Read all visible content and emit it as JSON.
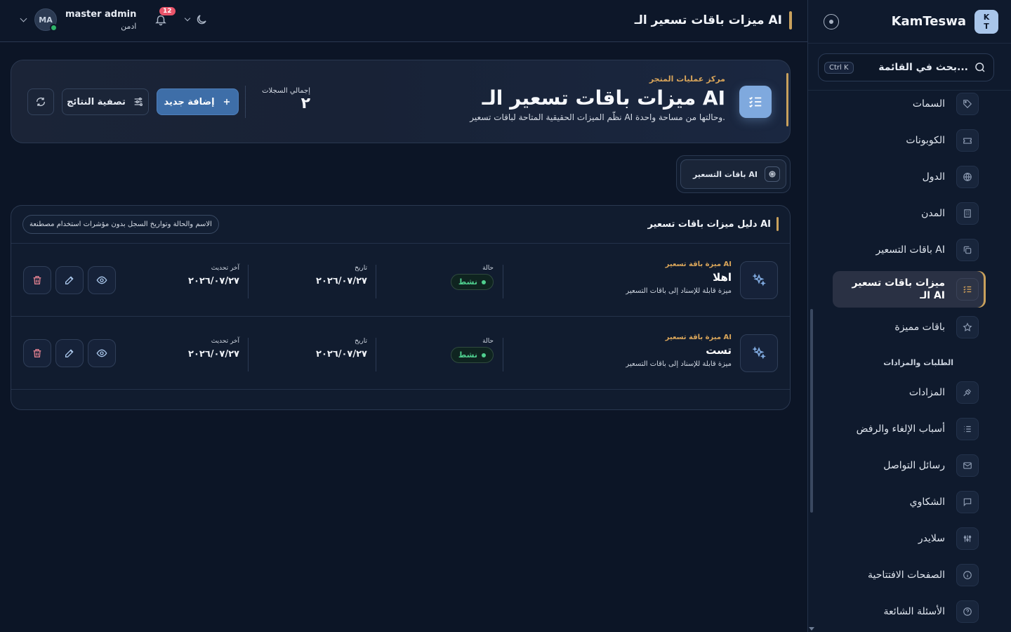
{
  "brand": {
    "logo_line1": "K",
    "logo_line2": "T",
    "name": "KamTeswa"
  },
  "search": {
    "placeholder": "بحث في القائمة...",
    "shortcut": "Ctrl K"
  },
  "sidebar": {
    "items": [
      {
        "label": "السمات",
        "icon": "tag-icon"
      },
      {
        "label": "الكوبونات",
        "icon": "ticket-icon"
      },
      {
        "label": "الدول",
        "icon": "globe-icon"
      },
      {
        "label": "المدن",
        "icon": "building-icon"
      },
      {
        "label": "باقات التسعير AI",
        "icon": "copy-icon"
      },
      {
        "label": "ميزات باقات تسعير الـ AI",
        "icon": "list-check-icon",
        "active": true
      },
      {
        "label": "باقات مميزة",
        "icon": "star-icon"
      }
    ],
    "section_label": "الطلبات والمزادات",
    "section_items": [
      {
        "label": "المزادات",
        "icon": "gavel-icon"
      },
      {
        "label": "أسباب الإلغاء والرفض",
        "icon": "list-icon"
      },
      {
        "label": "رسائل التواصل",
        "icon": "mail-icon"
      },
      {
        "label": "الشكاوي",
        "icon": "message-icon"
      },
      {
        "label": "سلايدر",
        "icon": "sliders-icon"
      },
      {
        "label": "الصفحات الافتتاحية",
        "icon": "info-icon"
      },
      {
        "label": "الأسئلة الشائعة",
        "icon": "help-icon"
      }
    ]
  },
  "topbar": {
    "page_title": "ميزات باقات تسعير الـ AI",
    "user_name": "master admin",
    "user_role": "ادمن",
    "avatar_initials": "MA",
    "notification_count": "12"
  },
  "hero": {
    "eyebrow": "مركز عمليات المتجر",
    "title": "ميزات باقات تسعير الـ AI",
    "subtitle": "نظّم الميزات الحقيقية المتاحة لباقات تسعير AI وحالتها من مساحة واحدة.",
    "stat_label": "إجمالي السجلات",
    "stat_value": "٢",
    "add_label": "إضافة جديد",
    "filter_label": "تصفية النتائج"
  },
  "tab": {
    "label": "باقات التسعير AI"
  },
  "table": {
    "title": "دليل ميزات باقات تسعير AI",
    "note": "الاسم والحالة وتواريخ السجل بدون مؤشرات استخدام مصطنعة",
    "rows": [
      {
        "kicker": "ميزة باقة تسعير AI",
        "name": "اهلا",
        "desc": "ميزة قابلة للإسناد إلى باقات التسعير",
        "status_label": "حالة",
        "status": "نشط",
        "date_label": "تاريخ",
        "date": "٢٠٢٦/٠٧/٢٧",
        "updated_label": "آخر تحديث",
        "updated": "٢٠٢٦/٠٧/٢٧"
      },
      {
        "kicker": "ميزة باقة تسعير AI",
        "name": "تست",
        "desc": "ميزة قابلة للإسناد إلى باقات التسعير",
        "status_label": "حالة",
        "status": "نشط",
        "date_label": "تاريخ",
        "date": "٢٠٢٦/٠٧/٢٧",
        "updated_label": "آخر تحديث",
        "updated": "٢٠٢٦/٠٧/٢٧"
      }
    ]
  },
  "colors": {
    "accent_gold": "#c9a15c",
    "primary_blue": "#3e6ea8",
    "status_green": "#4fd08f",
    "badge_red": "#e8546a"
  }
}
